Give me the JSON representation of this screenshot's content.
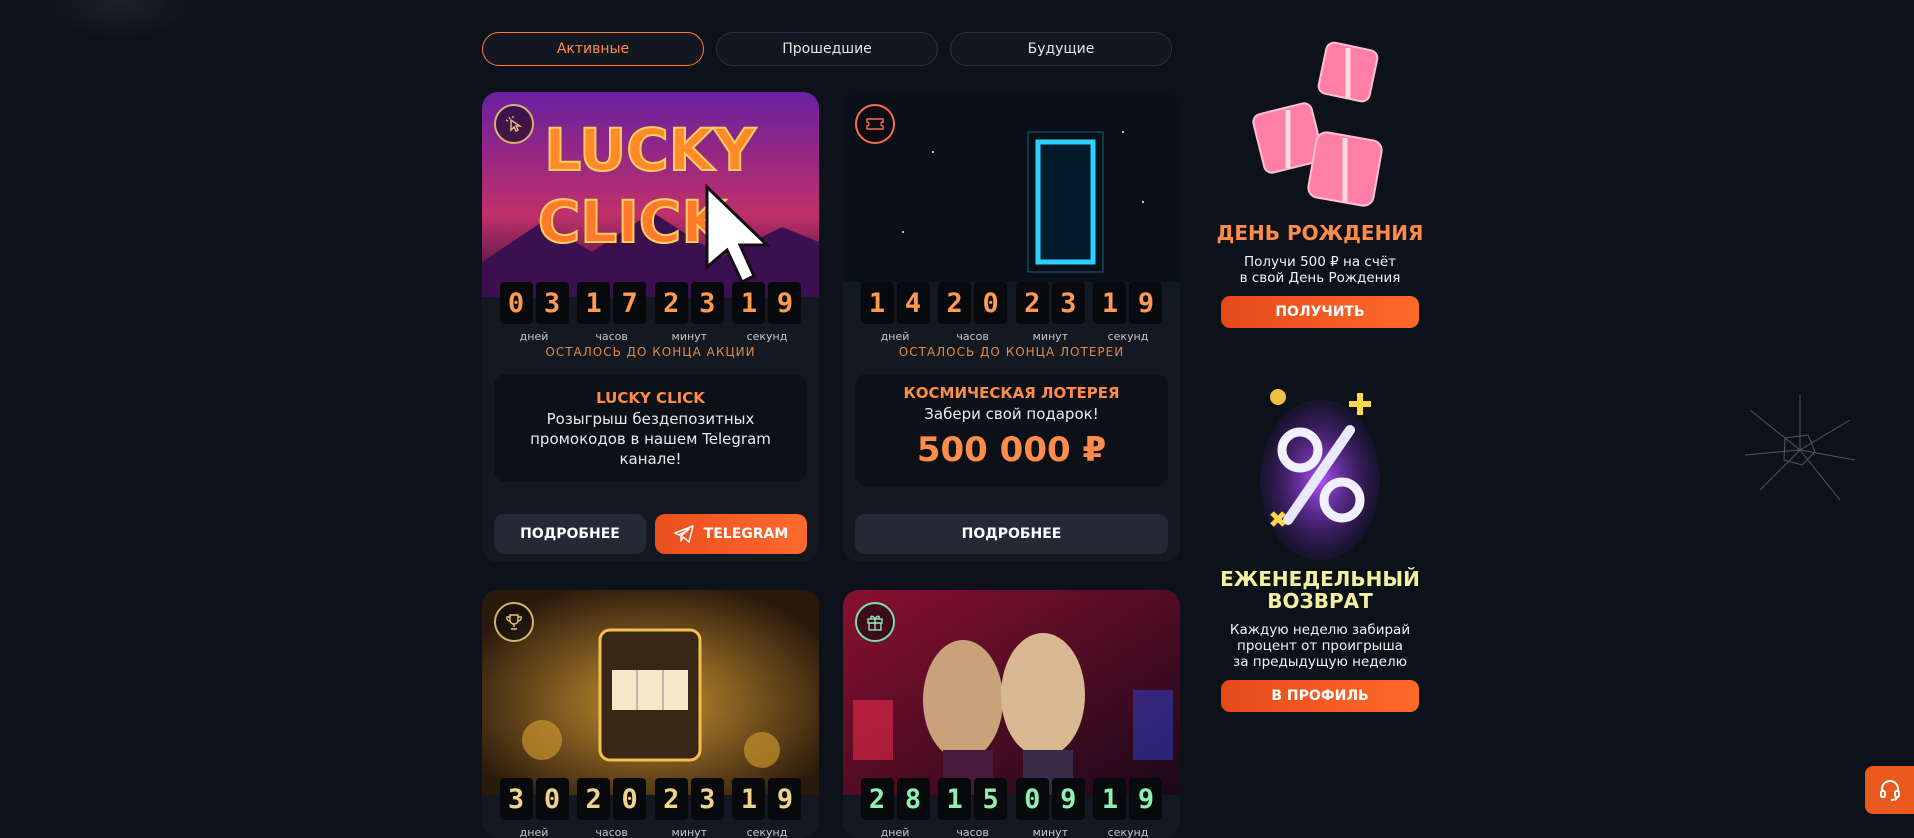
{
  "tabs": [
    {
      "label": "Активные",
      "active": true
    },
    {
      "label": "Прошедшие",
      "active": false
    },
    {
      "label": "Будущие",
      "active": false
    }
  ],
  "cards": [
    {
      "badge_icon": "pointer-click-icon",
      "timer": {
        "days": "03",
        "hours": "17",
        "minutes": "23",
        "seconds": "19"
      },
      "remain": "ОСТАЛОСЬ ДО КОНЦА АКЦИИ",
      "title": "LUCKY CLICK",
      "desc": "Розыгрыш бездепозитных промокодов в нашем Telegram канале!",
      "btn_more": "ПОДРОБНЕЕ",
      "btn_tg": "TELEGRAM",
      "image_text": [
        "LUCKY",
        "CLICK"
      ]
    },
    {
      "badge_icon": "ticket-icon",
      "timer": {
        "days": "14",
        "hours": "20",
        "minutes": "23",
        "seconds": "19"
      },
      "remain": "ОСТАЛОСЬ ДО КОНЦА ЛОТЕРЕИ",
      "title": "КОСМИЧЕСКАЯ ЛОТЕРЕЯ",
      "desc": "Забери свой подарок!",
      "prize": "500 000 ₽",
      "btn_more": "ПОДРОБНЕЕ"
    },
    {
      "badge_icon": "trophy-icon",
      "timer": {
        "days": "30",
        "hours": "20",
        "minutes": "23",
        "seconds": "19"
      }
    },
    {
      "badge_icon": "gift-icon",
      "timer": {
        "days": "28",
        "hours": "15",
        "minutes": "09",
        "seconds": "19"
      }
    }
  ],
  "timer_labels": {
    "days": "дней",
    "hours": "часов",
    "minutes": "минут",
    "seconds": "секунд"
  },
  "sidebar": {
    "birthday": {
      "title": "ДЕНЬ РОЖДЕНИЯ",
      "desc1": "Получи 500 ₽ на счёт",
      "desc2": "в свой День Рождения",
      "button": "ПОЛУЧИТЬ",
      "color": "#ff8a4a"
    },
    "weekly": {
      "title1": "ЕЖЕНЕДЕЛЬНЫЙ",
      "title2": "ВОЗВРАТ",
      "desc1": "Каждую неделю забирай",
      "desc2": "процент от проигрыша",
      "desc3": "за предыдущую неделю",
      "button": "В ПРОФИЛЬ",
      "color": "#f3f0a0"
    }
  },
  "support_icon": "headset-icon"
}
